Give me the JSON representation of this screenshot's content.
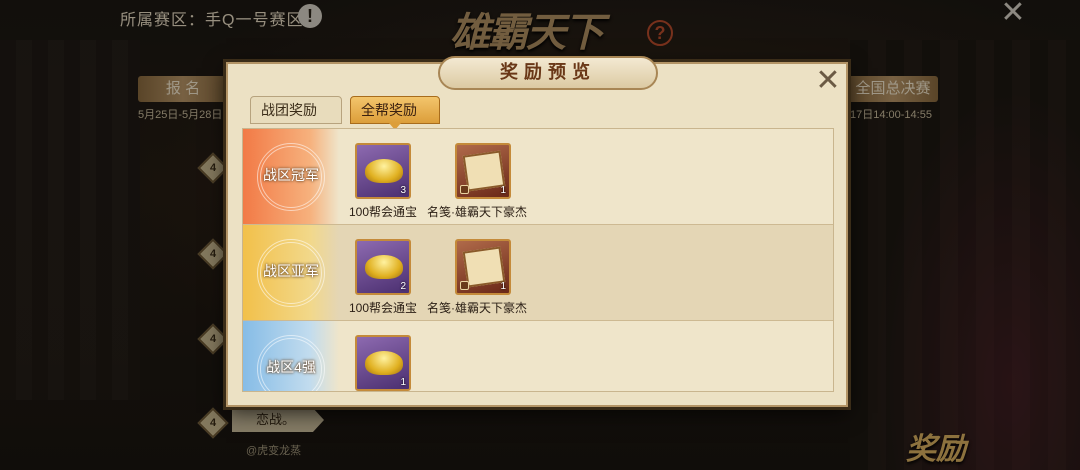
{
  "header": {
    "zone_label": "所属赛区：手Q一号赛区",
    "info_icon": "!",
    "title_logo": "雄霸天下",
    "help_icon": "?",
    "close_icon": "✕"
  },
  "stages": [
    {
      "label": "报 名",
      "date": "5月25日-5月28日"
    },
    {
      "label": "全国总决赛",
      "date": "17日14:00-14:55"
    }
  ],
  "step_badges": [
    "4",
    "4",
    "4",
    "4",
    "4"
  ],
  "chat": {
    "label": "恋战。",
    "sub": "@虎变龙蒸"
  },
  "bottom_reward_label": "奖励",
  "modal": {
    "title": "奖励预览",
    "close_icon": "✕",
    "tabs": [
      {
        "label": "战团奖励",
        "active": false
      },
      {
        "label": "全帮奖励",
        "active": true
      }
    ],
    "ranks": [
      {
        "label": "战区冠军",
        "color": "#f08a50",
        "items": [
          {
            "icon": "gold-ingot-icon",
            "rarity": "purple",
            "count": "3",
            "name": "100帮会通宝"
          },
          {
            "icon": "scroll-icon",
            "rarity": "red",
            "count": "1",
            "name": "名笺·雄霸天下豪杰"
          }
        ]
      },
      {
        "label": "战区亚军",
        "color": "#f0c050",
        "items": [
          {
            "icon": "gold-ingot-icon",
            "rarity": "purple",
            "count": "2",
            "name": "100帮会通宝"
          },
          {
            "icon": "scroll-icon",
            "rarity": "red",
            "count": "1",
            "name": "名笺·雄霸天下豪杰"
          }
        ]
      },
      {
        "label": "战区4强",
        "color": "#8cc0e8",
        "items": [
          {
            "icon": "gold-ingot-icon",
            "rarity": "purple",
            "count": "1",
            "name": ""
          }
        ]
      }
    ]
  }
}
